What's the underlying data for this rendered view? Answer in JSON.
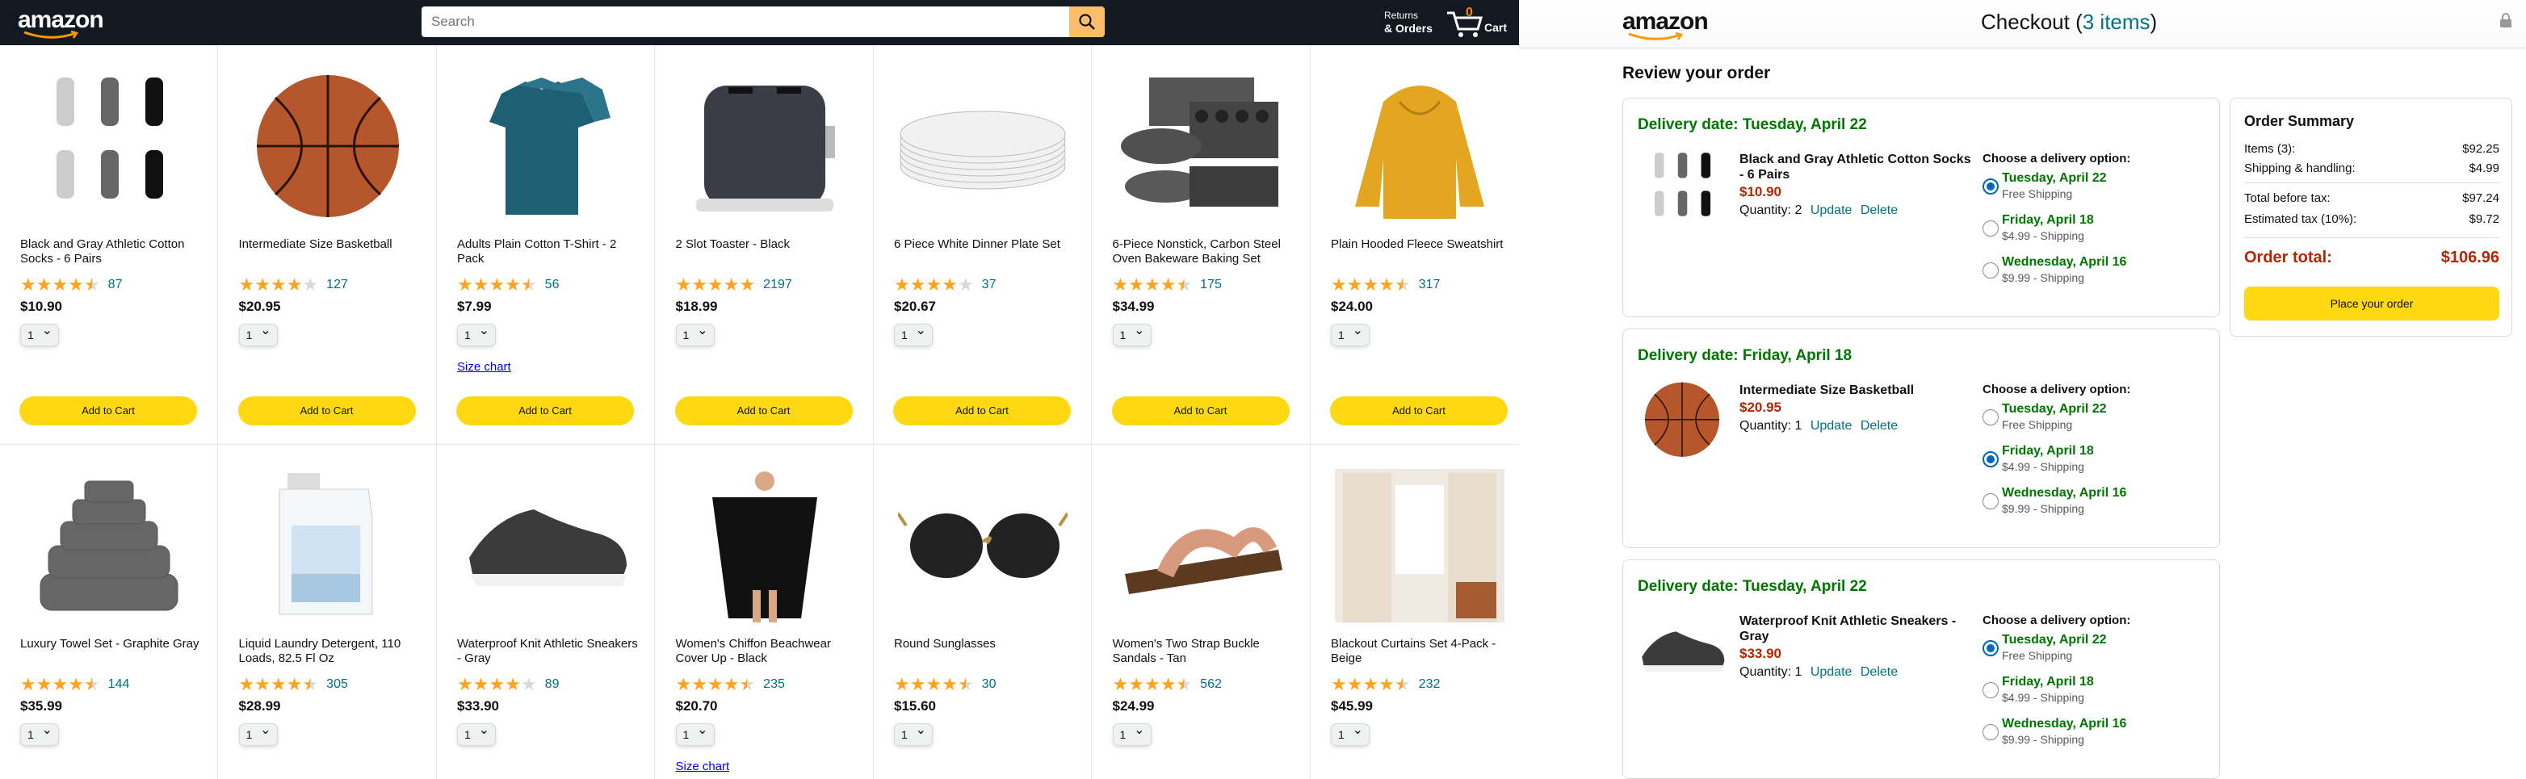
{
  "store": {
    "logo": "amazon",
    "search_placeholder": "Search",
    "returns_line1": "Returns",
    "returns_line2": "& Orders",
    "cart_count": "0",
    "cart_label": "Cart",
    "add_to_cart": "Add to Cart",
    "size_chart": "Size chart",
    "qty_default": "1",
    "products": [
      {
        "title": "Black and Gray Athletic Cotton Socks - 6 Pairs",
        "rating": 4.5,
        "count": "87",
        "price": "$10.90"
      },
      {
        "title": "Intermediate Size Basketball",
        "rating": 4.0,
        "count": "127",
        "price": "$20.95"
      },
      {
        "title": "Adults Plain Cotton T-Shirt - 2 Pack",
        "rating": 4.5,
        "count": "56",
        "price": "$7.99"
      },
      {
        "title": "2 Slot Toaster - Black",
        "rating": 5.0,
        "count": "2197",
        "price": "$18.99"
      },
      {
        "title": "6 Piece White Dinner Plate Set",
        "rating": 4.0,
        "count": "37",
        "price": "$20.67"
      },
      {
        "title": "6-Piece Nonstick, Carbon Steel Oven Bakeware Baking Set",
        "rating": 4.5,
        "count": "175",
        "price": "$34.99"
      },
      {
        "title": "Plain Hooded Fleece Sweatshirt",
        "rating": 4.5,
        "count": "317",
        "price": "$24.00"
      },
      {
        "title": "Luxury Towel Set - Graphite Gray",
        "rating": 4.5,
        "count": "144",
        "price": "$35.99"
      },
      {
        "title": "Liquid Laundry Detergent, 110 Loads, 82.5 Fl Oz",
        "rating": 4.5,
        "count": "305",
        "price": "$28.99"
      },
      {
        "title": "Waterproof Knit Athletic Sneakers - Gray",
        "rating": 4.0,
        "count": "89",
        "price": "$33.90"
      },
      {
        "title": "Women's Chiffon Beachwear Cover Up - Black",
        "rating": 4.5,
        "count": "235",
        "price": "$20.70"
      },
      {
        "title": "Round Sunglasses",
        "rating": 4.5,
        "count": "30",
        "price": "$15.60"
      },
      {
        "title": "Women's Two Strap Buckle Sandals - Tan",
        "rating": 4.5,
        "count": "562",
        "price": "$24.99"
      },
      {
        "title": "Blackout Curtains Set 4-Pack - Beige",
        "rating": 4.5,
        "count": "232",
        "price": "$45.99"
      }
    ]
  },
  "checkout": {
    "logo": "amazon",
    "title": "Checkout (",
    "items_link": "3 items",
    "title_end": ")",
    "review_heading": "Review your order",
    "choose_label": "Choose a delivery option:",
    "update": "Update",
    "delete": "Delete",
    "orders": [
      {
        "delivery": "Delivery date: Tuesday, April 22",
        "name": "Black and Gray Athletic Cotton Socks - 6 Pairs",
        "price": "$10.90",
        "quantity": "Quantity: 2",
        "options": [
          {
            "date": "Tuesday, April 22",
            "ship": "Free Shipping",
            "selected": true
          },
          {
            "date": "Friday, April 18",
            "ship": "$4.99 - Shipping",
            "selected": false
          },
          {
            "date": "Wednesday, April 16",
            "ship": "$9.99 - Shipping",
            "selected": false
          }
        ]
      },
      {
        "delivery": "Delivery date: Friday, April 18",
        "name": "Intermediate Size Basketball",
        "price": "$20.95",
        "quantity": "Quantity: 1",
        "options": [
          {
            "date": "Tuesday, April 22",
            "ship": "Free Shipping",
            "selected": false
          },
          {
            "date": "Friday, April 18",
            "ship": "$4.99 - Shipping",
            "selected": true
          },
          {
            "date": "Wednesday, April 16",
            "ship": "$9.99 - Shipping",
            "selected": false
          }
        ]
      },
      {
        "delivery": "Delivery date: Tuesday, April 22",
        "name": "Waterproof Knit Athletic Sneakers - Gray",
        "price": "$33.90",
        "quantity": "Quantity: 1",
        "options": [
          {
            "date": "Tuesday, April 22",
            "ship": "Free Shipping",
            "selected": true
          },
          {
            "date": "Friday, April 18",
            "ship": "$4.99 - Shipping",
            "selected": false
          },
          {
            "date": "Wednesday, April 16",
            "ship": "$9.99 - Shipping",
            "selected": false
          }
        ]
      }
    ],
    "summary": {
      "title": "Order Summary",
      "items_label": "Items (3):",
      "items_value": "$92.25",
      "shipping_label": "Shipping & handling:",
      "shipping_value": "$4.99",
      "before_tax_label": "Total before tax:",
      "before_tax_value": "$97.24",
      "tax_label": "Estimated tax (10%):",
      "tax_value": "$9.72",
      "total_label": "Order total:",
      "total_value": "$106.96",
      "place_order": "Place your order"
    }
  }
}
